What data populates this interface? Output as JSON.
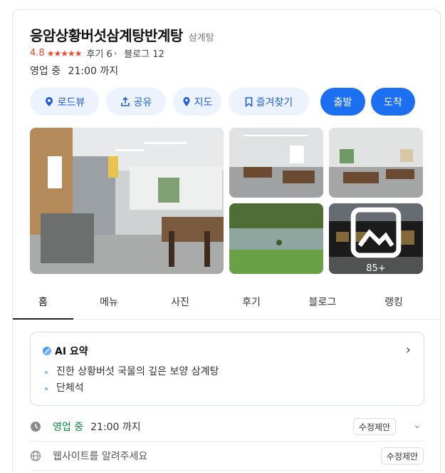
{
  "place": {
    "name": "응암상황버섯삼계탕반계탕",
    "category": "삼계탕",
    "rating": "4.8",
    "stars": "★★★★★",
    "review_label": "후기 6",
    "blog_label": "블로그 12",
    "hours_status": "영업 중",
    "hours_until": "21:00 까지"
  },
  "actions": {
    "roadview": "로드뷰",
    "share": "공유",
    "map": "지도",
    "favorite": "즐겨찾기",
    "departure": "출발",
    "arrival": "도착"
  },
  "photos": {
    "more_count": "85+"
  },
  "tabs": [
    "홈",
    "메뉴",
    "사진",
    "후기",
    "블로그",
    "랭킹"
  ],
  "ai_summary": {
    "title": "AI 요약",
    "items": [
      "진한 상황버섯 국물의 깊은 보양 삼계탕",
      "단체석"
    ]
  },
  "info": {
    "open_status": "영업 중",
    "open_time": "21:00 까지",
    "edit_label": "수정제안",
    "website_placeholder": "웹사이트를 알려주세요",
    "website_edit_label": "수정제안"
  },
  "colors": {
    "accent_blue": "#1c6ff0",
    "pill_bg": "#edf3fd",
    "rating_red": "#e04b2a",
    "open_green": "#0b8a3c"
  }
}
